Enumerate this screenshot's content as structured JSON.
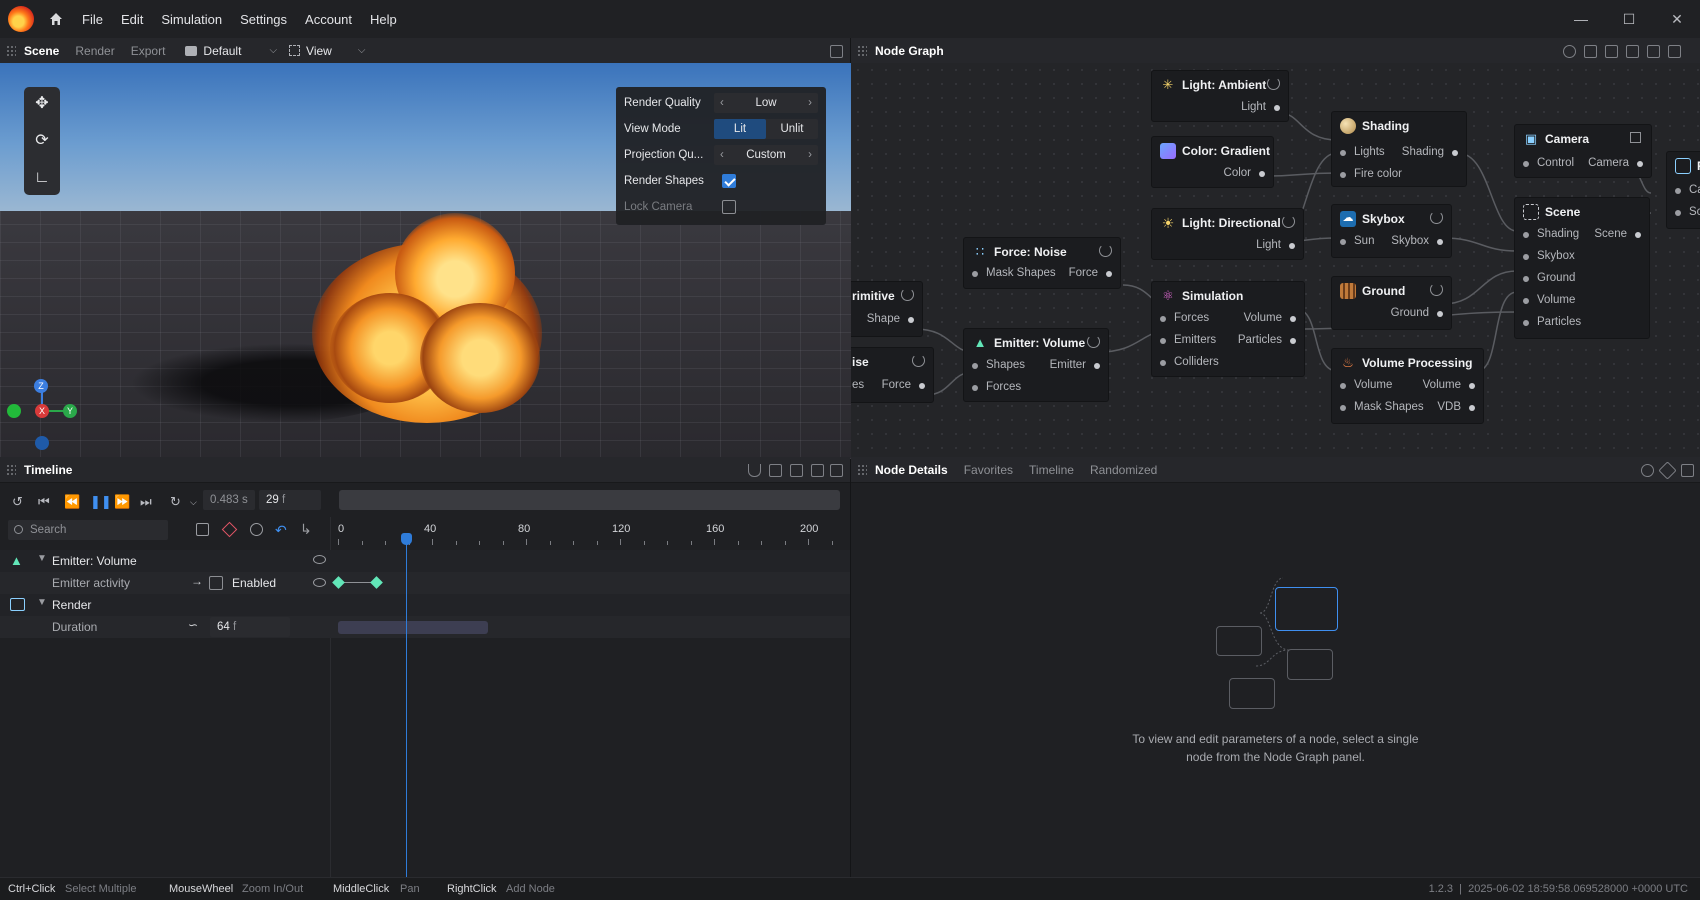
{
  "menu": [
    "File",
    "Edit",
    "Simulation",
    "Settings",
    "Account",
    "Help"
  ],
  "scene_panel": {
    "tabs": [
      "Scene",
      "Render",
      "Export"
    ],
    "preset": "Default",
    "view": "View"
  },
  "render_settings": {
    "render_quality_label": "Render Quality",
    "render_quality_value": "Low",
    "view_mode_label": "View Mode",
    "view_mode_options": [
      "Lit",
      "Unlit"
    ],
    "projection_label": "Projection Qu...",
    "projection_value": "Custom",
    "render_shapes_label": "Render Shapes",
    "render_shapes_checked": true,
    "lock_camera_label": "Lock Camera",
    "lock_camera_checked": false
  },
  "axes": {
    "z": "Z",
    "x": "X",
    "y": "Y"
  },
  "node_graph": {
    "title": "Node Graph",
    "nodes": {
      "light_ambient": {
        "title": "Light: Ambient",
        "outputs": [
          "Light"
        ]
      },
      "color_gradient": {
        "title": "Color: Gradient",
        "outputs": [
          "Color"
        ]
      },
      "light_directional": {
        "title": "Light: Directional",
        "outputs": [
          "Light"
        ]
      },
      "shading": {
        "title": "Shading",
        "inputs": [
          "Lights",
          "Fire color"
        ],
        "outputs": [
          "Shading"
        ]
      },
      "skybox": {
        "title": "Skybox",
        "inputs": [
          "Sun"
        ],
        "outputs": [
          "Skybox"
        ]
      },
      "ground": {
        "title": "Ground",
        "outputs": [
          "Ground"
        ]
      },
      "camera": {
        "title": "Camera",
        "inputs": [
          "Control"
        ],
        "outputs": [
          "Camera"
        ]
      },
      "scene": {
        "title": "Scene",
        "inputs": [
          "Shading",
          "Skybox",
          "Ground",
          "Volume",
          "Particles"
        ],
        "outputs": [
          "Scene"
        ]
      },
      "force_noise": {
        "title": "Force: Noise",
        "inputs": [
          "Mask Shapes"
        ],
        "outputs": [
          "Force"
        ]
      },
      "simulation": {
        "title": "Simulation",
        "inputs": [
          "Forces",
          "Emitters",
          "Colliders"
        ],
        "outputs": [
          "Volume",
          "Particles"
        ]
      },
      "emitter_volume": {
        "title": "Emitter: Volume",
        "inputs": [
          "Shapes",
          "Forces"
        ],
        "outputs": [
          "Emitter"
        ]
      },
      "volume_processing": {
        "title": "Volume Processing",
        "inputs": [
          "Volume",
          "Mask Shapes"
        ],
        "outputs": [
          "Volume",
          "VDB"
        ]
      },
      "primitive_partial": {
        "title": "rimitive",
        "outputs": [
          "Shape"
        ]
      },
      "noise_partial": {
        "title": "ise",
        "inputs": [
          "es"
        ],
        "outputs": [
          "Force"
        ]
      },
      "render_partial": {
        "title": "R",
        "inputs": [
          "Ca",
          "Sc"
        ]
      }
    }
  },
  "timeline": {
    "title": "Timeline",
    "time_seconds": "0.483",
    "time_unit": "s",
    "frame": "29",
    "frame_unit": "f",
    "search_placeholder": "Search",
    "ruler_ticks": [
      "0",
      "40",
      "80",
      "120",
      "160",
      "200"
    ],
    "tracks": {
      "emitter": "Emitter: Volume",
      "emitter_activity": "Emitter activity",
      "enabled": "Enabled",
      "render": "Render",
      "duration": "Duration",
      "duration_value": "64",
      "duration_unit": "f"
    },
    "playhead_frame": 29,
    "keyframes": [
      0,
      16
    ],
    "duration_bar": [
      0,
      64
    ]
  },
  "details": {
    "tabs": [
      "Node Details",
      "Favorites",
      "Timeline",
      "Randomized"
    ],
    "empty_message_line1": "To view and edit parameters of a node, select a single",
    "empty_message_line2": "node from the Node Graph panel."
  },
  "status": [
    {
      "key": "Ctrl+Click",
      "value": "Select Multiple"
    },
    {
      "key": "MouseWheel",
      "value": "Zoom In/Out"
    },
    {
      "key": "MiddleClick",
      "value": "Pan"
    },
    {
      "key": "RightClick",
      "value": "Add Node"
    }
  ],
  "status_right": "1.2.3  |  2025-06-02 18:59:58.069528000 +0000 UTC",
  "colors": {
    "accent": "#2f7cd9",
    "keyframe": "#62e6b8",
    "fire": "#ff9a2a"
  }
}
